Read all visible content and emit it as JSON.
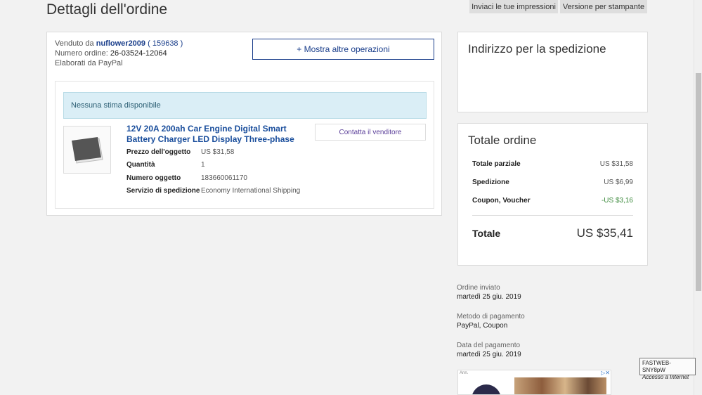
{
  "page": {
    "title": "Dettagli dell'ordine"
  },
  "top_buttons": {
    "feedback": "Inviaci le tue impressioni",
    "print": "Versione per stampante"
  },
  "seller": {
    "sold_by_label": "Venduto da",
    "name": "nuflower2009",
    "feedback_open": "(",
    "feedback_score": "159638",
    "feedback_close": ")",
    "order_number_label": "Numero ordine:",
    "order_number": "26-03524-12064",
    "processed_by": "Elaborati da PayPal"
  },
  "actions": {
    "more_ops": "+ Mostra altre operazioni",
    "contact_seller": "Contatta il venditore"
  },
  "shipping_estimate": {
    "message": "Nessuna stima disponibile"
  },
  "item": {
    "title": "12V 20A 200ah Car Engine Digital Smart Battery Charger LED Display Three-phase",
    "details": [
      {
        "label": "Prezzo dell'oggetto",
        "value": "US $31,58"
      },
      {
        "label": "Quantità",
        "value": "1"
      },
      {
        "label": "Numero oggetto",
        "value": "183660061170"
      },
      {
        "label": "Servizio di spedizione",
        "value": "Economy International Shipping"
      }
    ]
  },
  "address": {
    "heading": "Indirizzo per la spedizione"
  },
  "summary": {
    "heading": "Totale ordine",
    "rows": [
      {
        "label": "Totale parziale",
        "value": "US $31,58"
      },
      {
        "label": "Spedizione",
        "value": "US $6,99"
      },
      {
        "label": "Coupon, Voucher",
        "value": "-US $3,16"
      }
    ],
    "total_label": "Totale",
    "total_value": "US $35,41",
    "discount_color": "#3c8a3c"
  },
  "meta": [
    {
      "label": "Ordine inviato",
      "value": "martedì 25 giu. 2019"
    },
    {
      "label": "Metodo di pagamento",
      "value": "PayPal, Coupon"
    },
    {
      "label": "Data del pagamento",
      "value": "martedì 25 giu. 2019"
    }
  ],
  "ad": {
    "label": "Ann.",
    "close_icon": "close-icon"
  },
  "tooltip": {
    "line1": "FASTWEB-SNY8pW",
    "line2": "Accesso a Internet"
  },
  "colors": {
    "link": "#1a3e8b",
    "info_bg": "#daeef6",
    "page_bg": "#f2f2f2"
  }
}
